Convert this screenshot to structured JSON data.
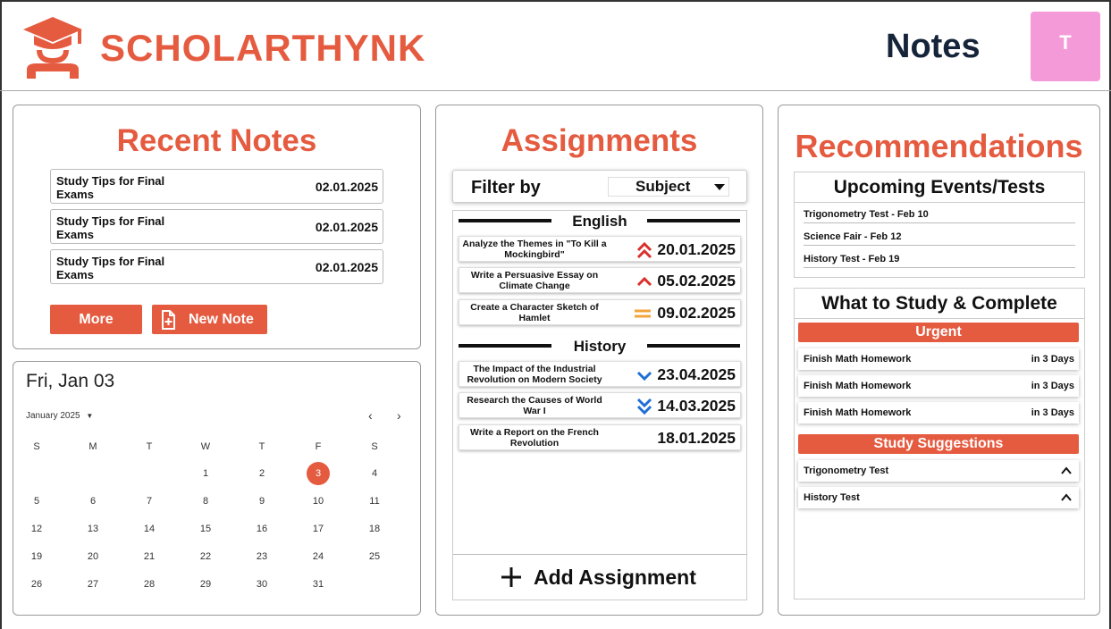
{
  "header": {
    "brand": "SCHOLARTHYNK",
    "page_title": "Notes",
    "avatar_initial": "T"
  },
  "recent_notes": {
    "title": "Recent Notes",
    "items": [
      {
        "title": "Study Tips for Final Exams",
        "date": "02.01.2025"
      },
      {
        "title": "Study Tips for Final Exams",
        "date": "02.01.2025"
      },
      {
        "title": "Study Tips for Final Exams",
        "date": "02.01.2025"
      }
    ],
    "more_label": "More",
    "new_note_label": "New Note"
  },
  "calendar": {
    "selected_label": "Fri, Jan 03",
    "month_label": "January 2025",
    "weekdays": [
      "S",
      "M",
      "T",
      "W",
      "T",
      "F",
      "S"
    ],
    "days": [
      "1",
      "2",
      "3",
      "4",
      "5",
      "6",
      "7",
      "8",
      "9",
      "10",
      "11",
      "12",
      "13",
      "14",
      "15",
      "16",
      "17",
      "18",
      "19",
      "20",
      "21",
      "22",
      "23",
      "24",
      "25",
      "26",
      "27",
      "28",
      "29",
      "30",
      "31"
    ],
    "selected_day": "3"
  },
  "assignments": {
    "title": "Assignments",
    "filter_label": "Filter by",
    "filter_value": "Subject",
    "sections": [
      {
        "name": "English",
        "items": [
          {
            "title": "Analyze the Themes in \"To Kill a Mockingbird\"",
            "date": "20.01.2025",
            "priority_icon": "double-chevron-up-icon"
          },
          {
            "title": "Write a Persuasive Essay on Climate Change",
            "date": "05.02.2025",
            "priority_icon": "chevron-up-icon"
          },
          {
            "title": "Create a Character Sketch of Hamlet",
            "date": "09.02.2025",
            "priority_icon": "equals-icon"
          }
        ]
      },
      {
        "name": "History",
        "items": [
          {
            "title": "The Impact of the Industrial Revolution on Modern Society",
            "date": "23.04.2025",
            "priority_icon": "chevron-down-icon"
          },
          {
            "title": "Research the Causes of World War I",
            "date": "14.03.2025",
            "priority_icon": "double-chevron-down-icon"
          },
          {
            "title": "Write a Report on the French Revolution",
            "date": "18.01.2025",
            "priority_icon": ""
          }
        ]
      }
    ],
    "add_label": "Add Assignment"
  },
  "recommendations": {
    "title": "Recommendations",
    "events_title": "Upcoming Events/Tests",
    "events": [
      "Trigonometry Test - Feb 10",
      "Science Fair - Feb 12",
      "History Test - Feb 19"
    ],
    "study_title": "What to Study & Complete",
    "urgent_label": "Urgent",
    "urgent_items": [
      {
        "name": "Finish Math Homework",
        "due": "in 3 Days"
      },
      {
        "name": "Finish Math Homework",
        "due": "in 3 Days"
      },
      {
        "name": "Finish Math Homework",
        "due": "in 3 Days"
      }
    ],
    "suggestions_label": "Study Suggestions",
    "suggestions": [
      "Trigonometry Test",
      "History Test"
    ]
  },
  "colors": {
    "accent": "#e55b40",
    "navy": "#16243a",
    "avatar": "#f49ad8",
    "high": "#d9302c",
    "medium": "#f2a53a",
    "low": "#1f6fd6"
  }
}
